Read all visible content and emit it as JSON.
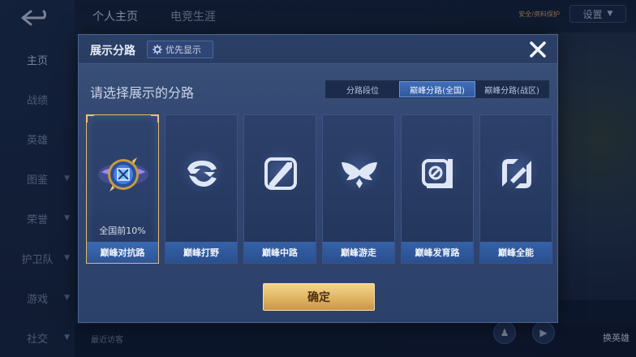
{
  "background": {
    "sidebar_items": [
      {
        "label": "主页",
        "has_arrow": false
      },
      {
        "label": "战绩",
        "has_arrow": false
      },
      {
        "label": "英雄",
        "has_arrow": false
      },
      {
        "label": "图鉴",
        "has_arrow": true
      },
      {
        "label": "荣誉",
        "has_arrow": true
      },
      {
        "label": "护卫队",
        "has_arrow": true
      },
      {
        "label": "游戏",
        "has_arrow": true
      },
      {
        "label": "社交",
        "has_arrow": true
      }
    ],
    "tabs": [
      {
        "label": "个人主页"
      },
      {
        "label": "电竞生涯"
      }
    ],
    "settings_label": "设置",
    "badge_text": "安全/资料保护",
    "visitors_label": "最近访客",
    "swap_hero_label": "换英雄"
  },
  "modal": {
    "title": "展示分路",
    "priority_label": "优先显示",
    "select_label": "请选择展示的分路",
    "segments": [
      {
        "label": "分路段位",
        "active": false
      },
      {
        "label": "巅峰分路(全国)",
        "active": true
      },
      {
        "label": "巅峰分路(战区)",
        "active": false
      }
    ],
    "cards": [
      {
        "name": "巅峰对抗路",
        "sub": "全国前10%",
        "selected": true,
        "icon": "clash-lane-emblem-icon"
      },
      {
        "name": "巅峰打野",
        "sub": "",
        "selected": false,
        "icon": "jungle-icon"
      },
      {
        "name": "巅峰中路",
        "sub": "",
        "selected": false,
        "icon": "mid-lane-icon"
      },
      {
        "name": "巅峰游走",
        "sub": "",
        "selected": false,
        "icon": "roam-icon"
      },
      {
        "name": "巅峰发育路",
        "sub": "",
        "selected": false,
        "icon": "farm-lane-icon"
      },
      {
        "name": "巅峰全能",
        "sub": "",
        "selected": false,
        "icon": "all-round-icon"
      }
    ],
    "confirm_label": "确定"
  },
  "colors": {
    "accent_gold": "#e2b867",
    "segment_active": "#3f6fb8",
    "card_footer": "#3562a8"
  }
}
